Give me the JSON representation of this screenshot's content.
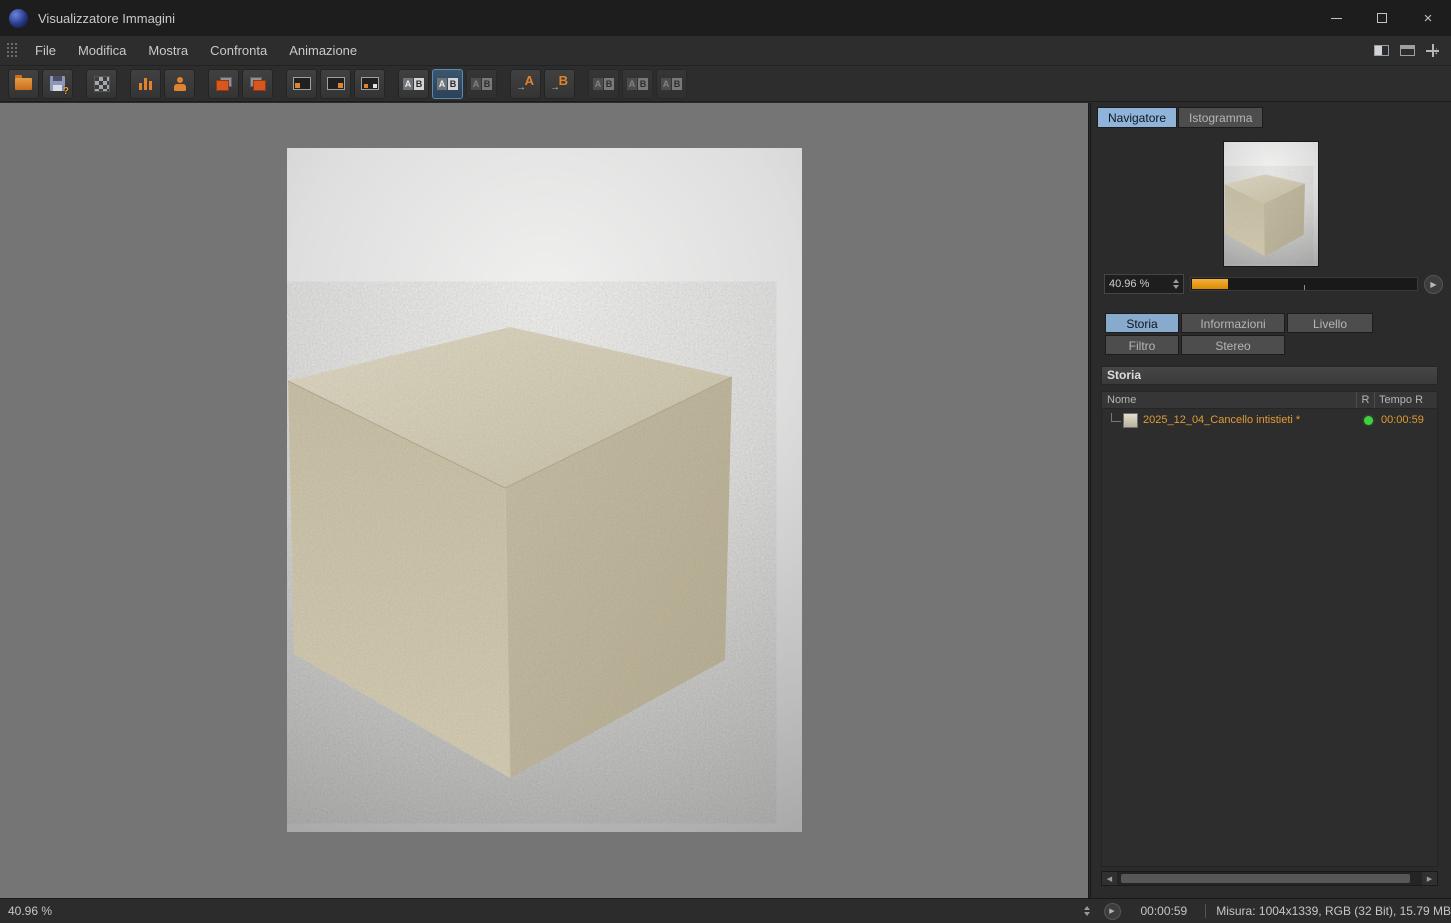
{
  "window": {
    "title": "Visualizzatore Immagini",
    "close_glyph": "×"
  },
  "menu": {
    "items": [
      "File",
      "Modifica",
      "Mostra",
      "Confronta",
      "Animazione"
    ]
  },
  "toolbar": {
    "save_badge": "?",
    "ab_a": "A",
    "ab_b": "B",
    "set_a": "A",
    "set_b": "B",
    "set_arrow": "→"
  },
  "navigator": {
    "tabs": [
      {
        "label": "Navigatore",
        "active": true
      },
      {
        "label": "Istogramma",
        "active": false
      }
    ],
    "zoom": "40.96 %"
  },
  "panel": {
    "tabs": [
      {
        "label": "Storia",
        "active": true
      },
      {
        "label": "Informazioni",
        "active": false
      },
      {
        "label": "Livello",
        "active": false
      },
      {
        "label": "Filtro",
        "active": false
      },
      {
        "label": "Stereo",
        "active": false
      }
    ],
    "section_title": "Storia",
    "columns": [
      "Nome",
      "R",
      "Tempo R"
    ],
    "rows": [
      {
        "name": "2025_12_04_Cancello intistieti *",
        "render_status": "green",
        "time": "00:00:59"
      }
    ]
  },
  "statusbar": {
    "zoom": "40.96 %",
    "time": "00:00:59",
    "info": "Misura: 1004x1339, RGB (32 Bit), 15.79 MB"
  },
  "glyphs": {
    "play": "▶",
    "go": "▶",
    "scroll_left": "◀",
    "scroll_right": "▶",
    "down": "↓"
  },
  "colors": {
    "accent_orange": "#e0832f",
    "row_text_orange": "#e09a35",
    "active_tab_blue": "#87aacd",
    "status_green": "#3fd13f",
    "viewport_gray": "#757575"
  }
}
